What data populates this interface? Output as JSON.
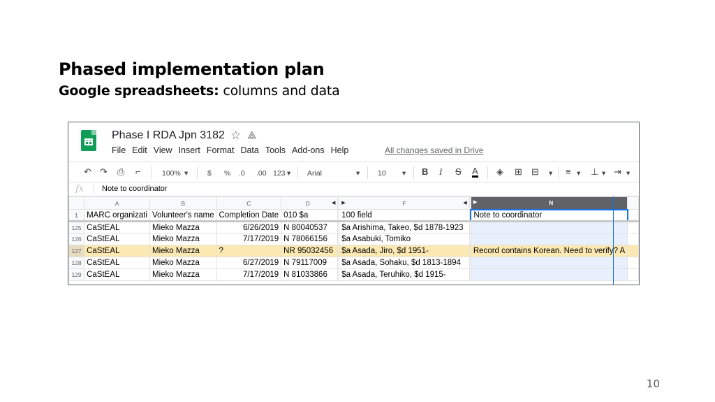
{
  "slide": {
    "title": "Phased implementation plan",
    "subtitle_bold": "Google spreadsheets:",
    "subtitle_rest": " columns and data",
    "page_number": "10"
  },
  "app": {
    "doc_title": "Phase I RDA Jpn 3182",
    "menu": [
      "File",
      "Edit",
      "View",
      "Insert",
      "Format",
      "Data",
      "Tools",
      "Add-ons",
      "Help"
    ],
    "saved_status": "All changes saved in Drive",
    "brand_color": "#0f9d58"
  },
  "toolbar": {
    "zoom": "100%",
    "currency": "$",
    "percent": "%",
    "dec_less": ".0",
    "dec_more": ".00",
    "number_format": "123",
    "font": "Arial",
    "font_size": "10",
    "bold": "B",
    "italic": "I",
    "strike": "S",
    "text_color": "A"
  },
  "formula_bar": {
    "fx": "fx",
    "value": "Note to coordinator"
  },
  "grid": {
    "columns": [
      "A",
      "B",
      "C",
      "D",
      "F",
      "N"
    ],
    "header_row": {
      "num": "1",
      "cells": [
        "MARC organizati",
        "Volunteer's name",
        "Completion Date",
        "010 $a",
        "100 field",
        "Note to coordinator"
      ]
    },
    "rows": [
      {
        "num": "125",
        "cells": [
          "CaStEAL",
          "Mieko Mazza",
          "6/26/2019",
          "N 80040537",
          "$a Arishima, Takeo, $d 1878-1923",
          ""
        ]
      },
      {
        "num": "126",
        "cells": [
          "CaStEAL",
          "Mieko Mazza",
          "7/17/2019",
          "N 78066156",
          "$a Asabuki, Tomiko",
          ""
        ]
      },
      {
        "num": "127",
        "cells": [
          "CaStEAL",
          "Mieko Mazza",
          "?",
          "NR 95032456",
          "$a Asada, Jiro, $d 1951-",
          "Record contains Korean. Need to verify? A"
        ]
      },
      {
        "num": "128",
        "cells": [
          "CaStEAL",
          "Mieko Mazza",
          "6/27/2019",
          "N 79117009",
          "$a Asada, Sohaku, $d 1813-1894",
          ""
        ]
      },
      {
        "num": "129",
        "cells": [
          "CaStEAL",
          "Mieko Mazza",
          "7/17/2019",
          "N 81033866",
          "$a Asada, Teruhiko, $d 1915-",
          ""
        ]
      }
    ],
    "highlight_color": "#fce8b2"
  }
}
